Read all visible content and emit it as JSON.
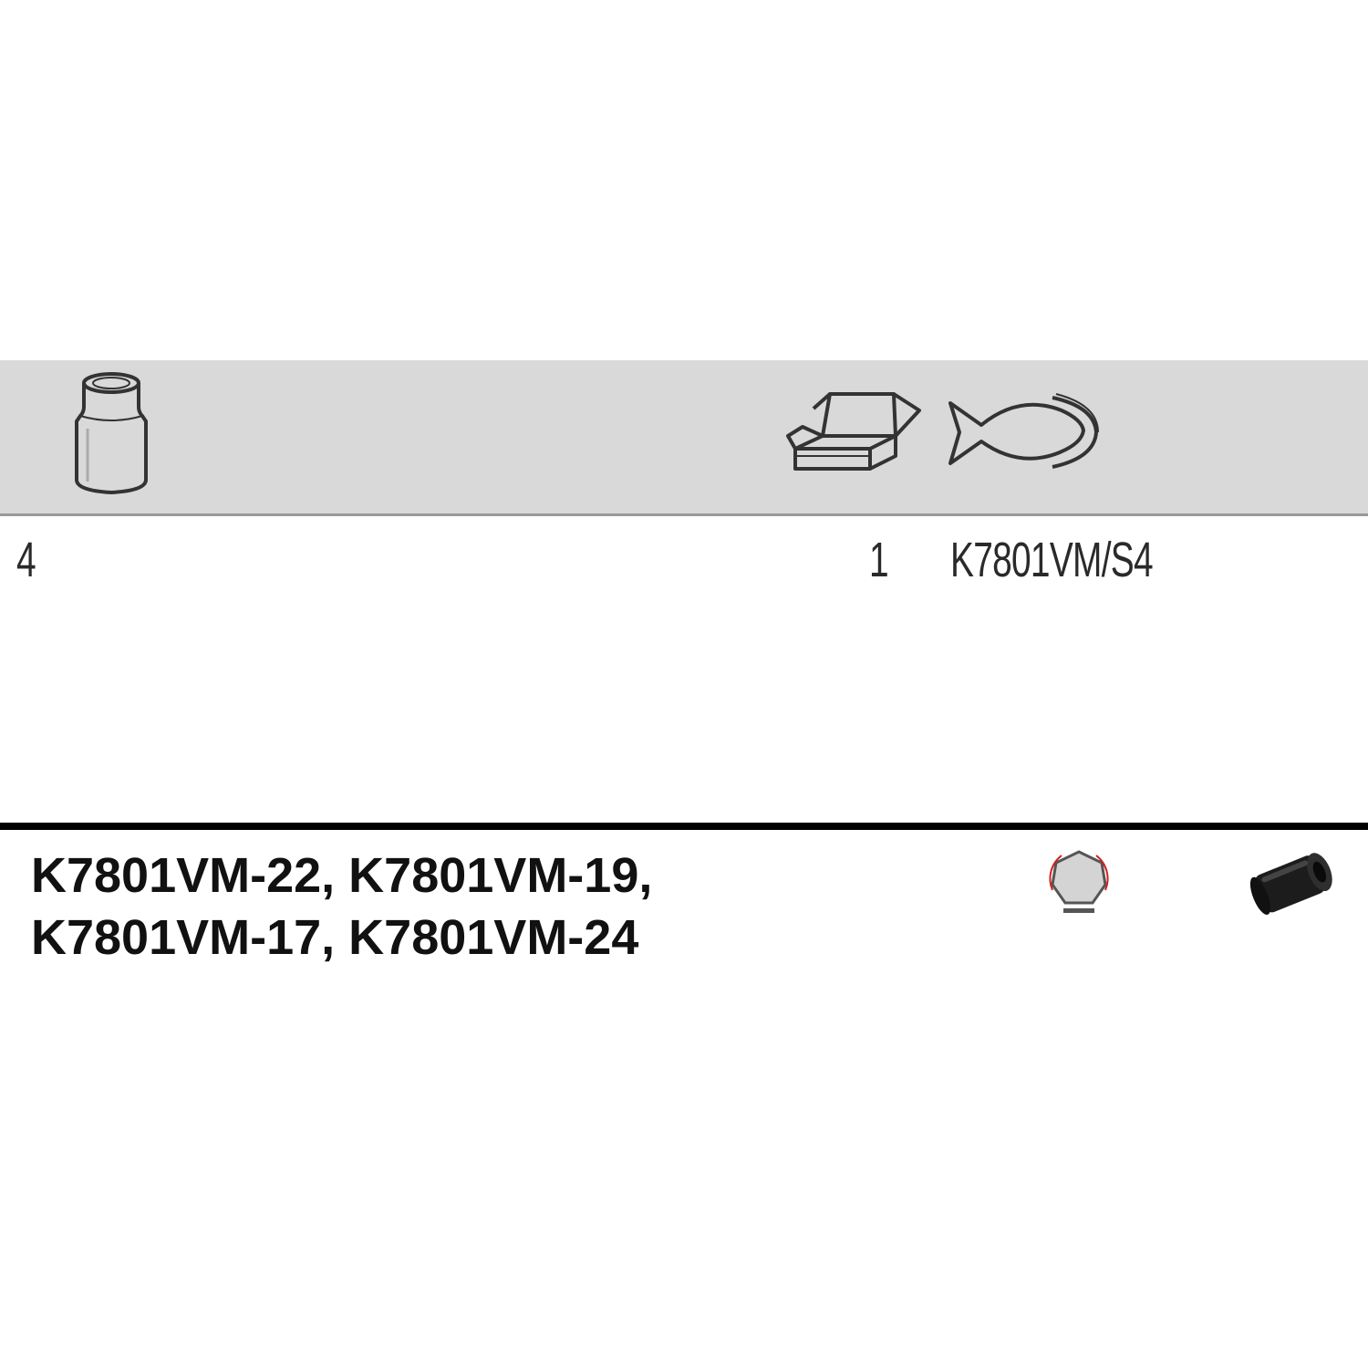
{
  "header": {
    "icons": [
      "socket-icon",
      "box-icon",
      "blister-pack-icon"
    ]
  },
  "row": {
    "count": "4",
    "pack_quantity": "1",
    "code": "K7801VM/S4"
  },
  "contents": {
    "line1": "K7801VM-22, K7801VM-19,",
    "line2": "K7801VM-17, K7801VM-24",
    "icons": [
      "hexagon-profile-icon",
      "impact-socket-icon"
    ]
  },
  "colors": {
    "header_band": "#d9d9d9",
    "divider": "#000000",
    "accent_red": "#cc2222"
  }
}
